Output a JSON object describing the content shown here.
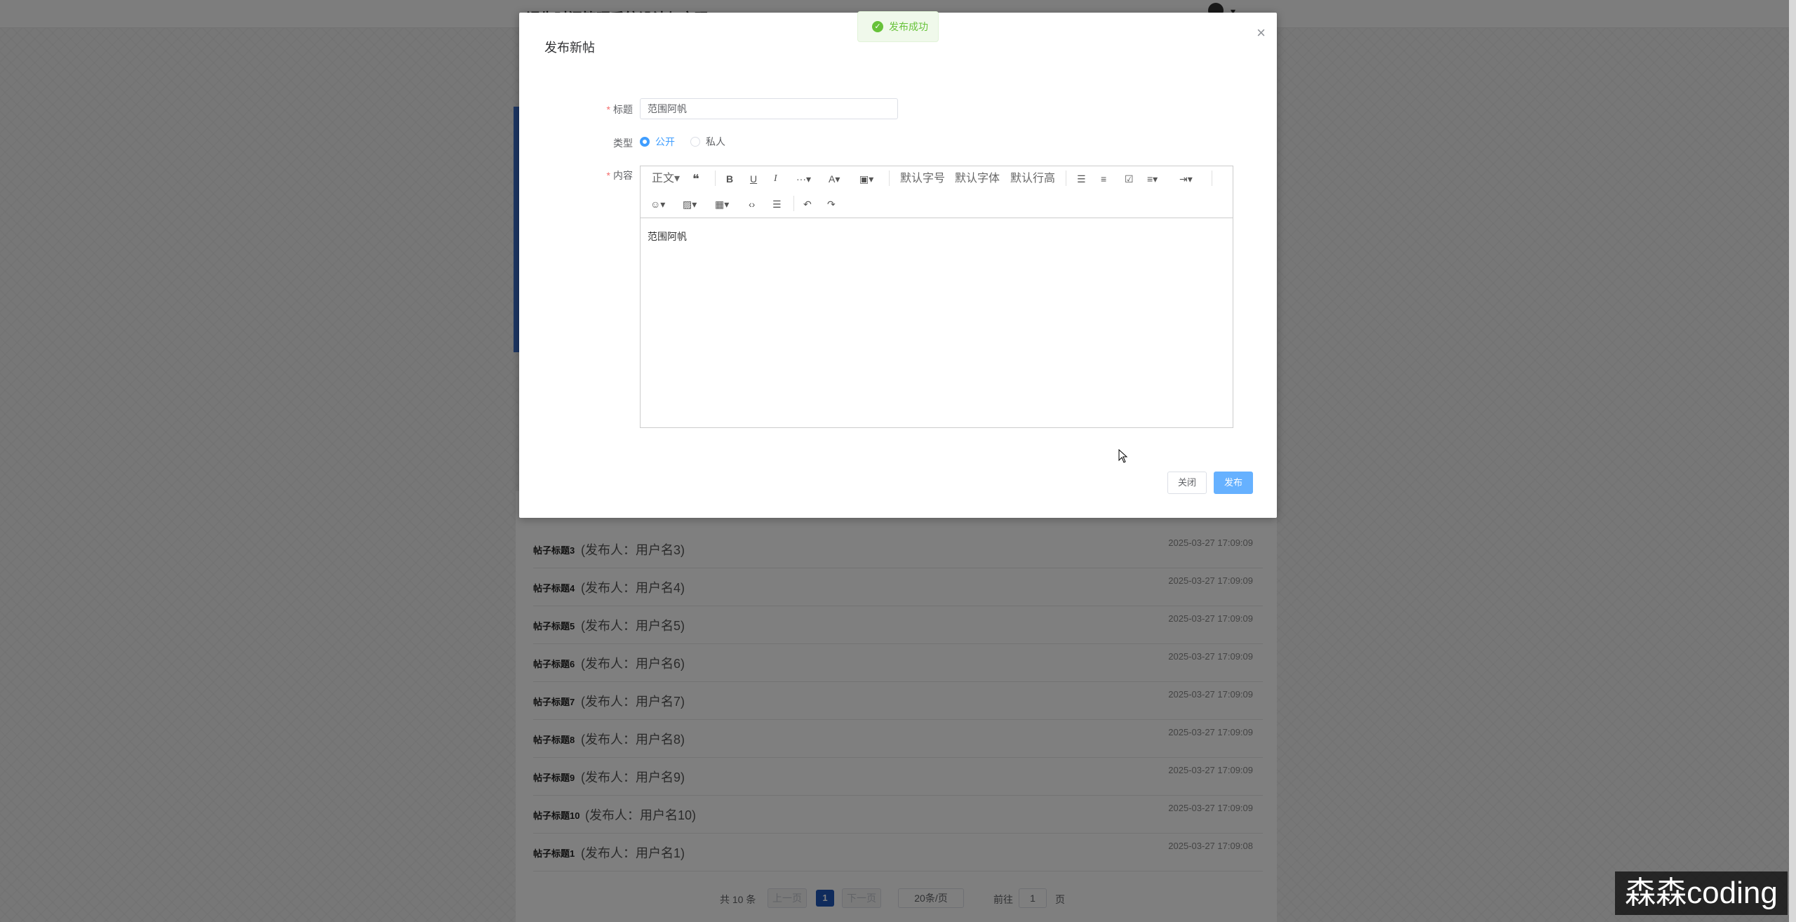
{
  "app": {
    "site_title": "课生时间管理系统设计与实现"
  },
  "posts": [
    {
      "title": "帖子标题3",
      "author": "(发布人：用户名3)",
      "time": "2025-03-27 17:09:09"
    },
    {
      "title": "帖子标题4",
      "author": "(发布人：用户名4)",
      "time": "2025-03-27 17:09:09"
    },
    {
      "title": "帖子标题5",
      "author": "(发布人：用户名5)",
      "time": "2025-03-27 17:09:09"
    },
    {
      "title": "帖子标题6",
      "author": "(发布人：用户名6)",
      "time": "2025-03-27 17:09:09"
    },
    {
      "title": "帖子标题7",
      "author": "(发布人：用户名7)",
      "time": "2025-03-27 17:09:09"
    },
    {
      "title": "帖子标题8",
      "author": "(发布人：用户名8)",
      "time": "2025-03-27 17:09:09"
    },
    {
      "title": "帖子标题9",
      "author": "(发布人：用户名9)",
      "time": "2025-03-27 17:09:09"
    },
    {
      "title": "帖子标题10",
      "author": "(发布人：用户名10)",
      "time": "2025-03-27 17:09:09"
    },
    {
      "title": "帖子标题1",
      "author": "(发布人：用户名1)",
      "time": "2025-03-27 17:09:08"
    }
  ],
  "pagination": {
    "total_text": "共 10 条",
    "prev": "上一页",
    "current_page": "1",
    "next": "下一页",
    "page_size": "20条/页",
    "jump_label": "前往",
    "jump_value": "1",
    "jump_unit": "页"
  },
  "dialog": {
    "title": "发布新帖",
    "close_icon": "×",
    "fields": {
      "title_label": "标题",
      "title_value": "范围阿帆",
      "type_label": "类型",
      "type_options": [
        "公开",
        "私人"
      ],
      "type_selected": "公开",
      "content_label": "内容",
      "content_value": "范围阿帆"
    },
    "toolbar": {
      "paragraph": "正文",
      "font_size": "默认字号",
      "font_family": "默认字体",
      "line_height": "默认行高"
    },
    "buttons": {
      "close": "关闭",
      "publish": "发布"
    }
  },
  "toast": {
    "message": "发布成功",
    "type": "success"
  },
  "watermark": "森森coding",
  "colors": {
    "primary": "#409eff",
    "publish_button": "#66b1ff",
    "success": "#67c23a",
    "required": "#f56c6c",
    "page_active": "#1f57b8"
  }
}
